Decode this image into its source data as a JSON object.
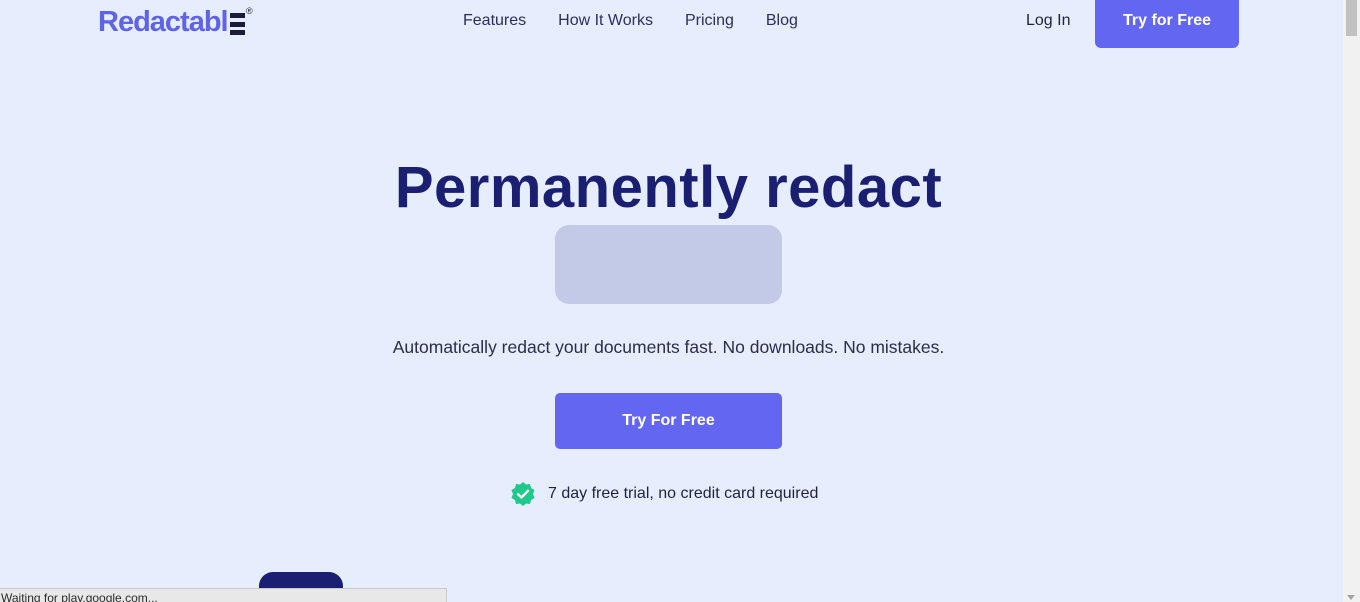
{
  "brand": {
    "logo_text": "Redactabl",
    "registered_mark": "®",
    "accent_color": "#6366f1",
    "title_color": "#1a1f71"
  },
  "nav": {
    "items": [
      {
        "label": "Features"
      },
      {
        "label": "How It Works"
      },
      {
        "label": "Pricing"
      },
      {
        "label": "Blog"
      }
    ],
    "login_label": "Log In",
    "cta_label": "Try for Free"
  },
  "hero": {
    "title": "Permanently redact",
    "subtitle": "Automatically redact your documents fast. No downloads. No mistakes.",
    "cta_label": "Try For Free",
    "trial_text": "7 day free trial, no credit card required",
    "trial_icon": "verified-badge-icon"
  },
  "status_bar": {
    "text": "Waiting for play.google.com..."
  }
}
